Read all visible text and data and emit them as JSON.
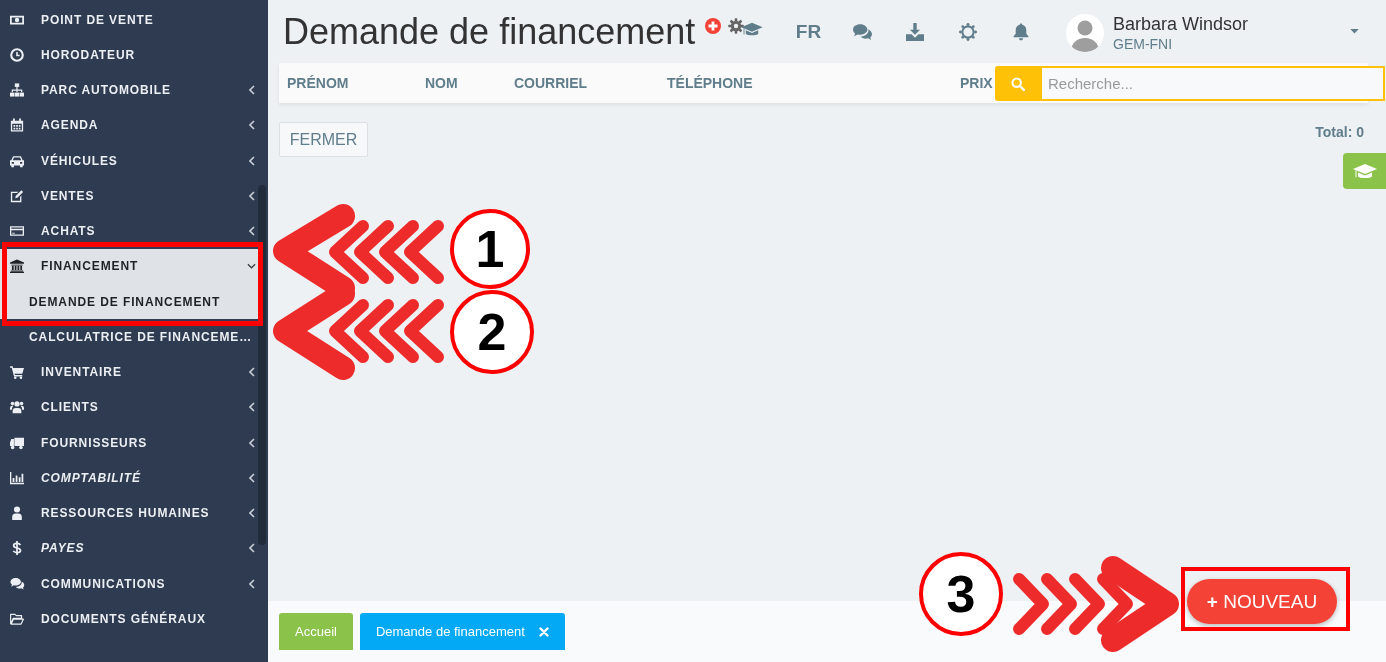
{
  "sidebar": {
    "items": [
      {
        "label": "POINT DE VENTE",
        "kind": "link",
        "italic": false,
        "selected": false,
        "expanded": false
      },
      {
        "label": "HORODATEUR",
        "kind": "link",
        "italic": false,
        "selected": false,
        "expanded": false
      },
      {
        "label": "PARC AUTOMOBILE",
        "kind": "group",
        "italic": false,
        "selected": false,
        "expanded": false
      },
      {
        "label": "AGENDA",
        "kind": "group",
        "italic": false,
        "selected": false,
        "expanded": false
      },
      {
        "label": "VÉHICULES",
        "kind": "group",
        "italic": false,
        "selected": false,
        "expanded": false
      },
      {
        "label": "VENTES",
        "kind": "group",
        "italic": false,
        "selected": false,
        "expanded": false
      },
      {
        "label": "ACHATS",
        "kind": "group",
        "italic": false,
        "selected": false,
        "expanded": false
      },
      {
        "label": "FINANCEMENT",
        "kind": "group",
        "italic": false,
        "selected": true,
        "expanded": true,
        "children": [
          {
            "label": "DEMANDE DE FINANCEMENT",
            "selected": true
          },
          {
            "label": "CALCULATRICE DE FINANCEME…",
            "selected": false
          }
        ]
      },
      {
        "label": "INVENTAIRE",
        "kind": "group",
        "italic": false,
        "selected": false,
        "expanded": false
      },
      {
        "label": "CLIENTS",
        "kind": "group",
        "italic": false,
        "selected": false,
        "expanded": false
      },
      {
        "label": "FOURNISSEURS",
        "kind": "group",
        "italic": false,
        "selected": false,
        "expanded": false
      },
      {
        "label": "COMPTABILITÉ",
        "kind": "group",
        "italic": true,
        "selected": false,
        "expanded": false
      },
      {
        "label": "RESSOURCES HUMAINES",
        "kind": "group",
        "italic": false,
        "selected": false,
        "expanded": false
      },
      {
        "label": "PAYES",
        "kind": "group",
        "italic": true,
        "selected": false,
        "expanded": false
      },
      {
        "label": "COMMUNICATIONS",
        "kind": "group",
        "italic": false,
        "selected": false,
        "expanded": false
      },
      {
        "label": "DOCUMENTS GÉNÉRAUX",
        "kind": "link",
        "italic": false,
        "selected": false,
        "expanded": false
      }
    ]
  },
  "header": {
    "title": "Demande de financement",
    "language": "FR",
    "user": {
      "name": "Barbara Windsor",
      "company": "GEM-FNI"
    }
  },
  "table": {
    "columns": [
      "PRÉNOM",
      "NOM",
      "COURRIEL",
      "TÉLÉPHONE",
      "PRIX"
    ],
    "search": {
      "placeholder": "Recherche..."
    }
  },
  "toolbar": {
    "close_button": "FERMER",
    "total": "Total: 0"
  },
  "footer_tabs": [
    {
      "label": "Accueil",
      "color": "#8bc34a",
      "closable": false
    },
    {
      "label": "Demande de financement",
      "color": "#03a9f4",
      "closable": true
    }
  ],
  "new_button": "**+** NOUVEAU",
  "annotations": [
    {
      "number": "1"
    },
    {
      "number": "2"
    },
    {
      "number": "3"
    }
  ]
}
